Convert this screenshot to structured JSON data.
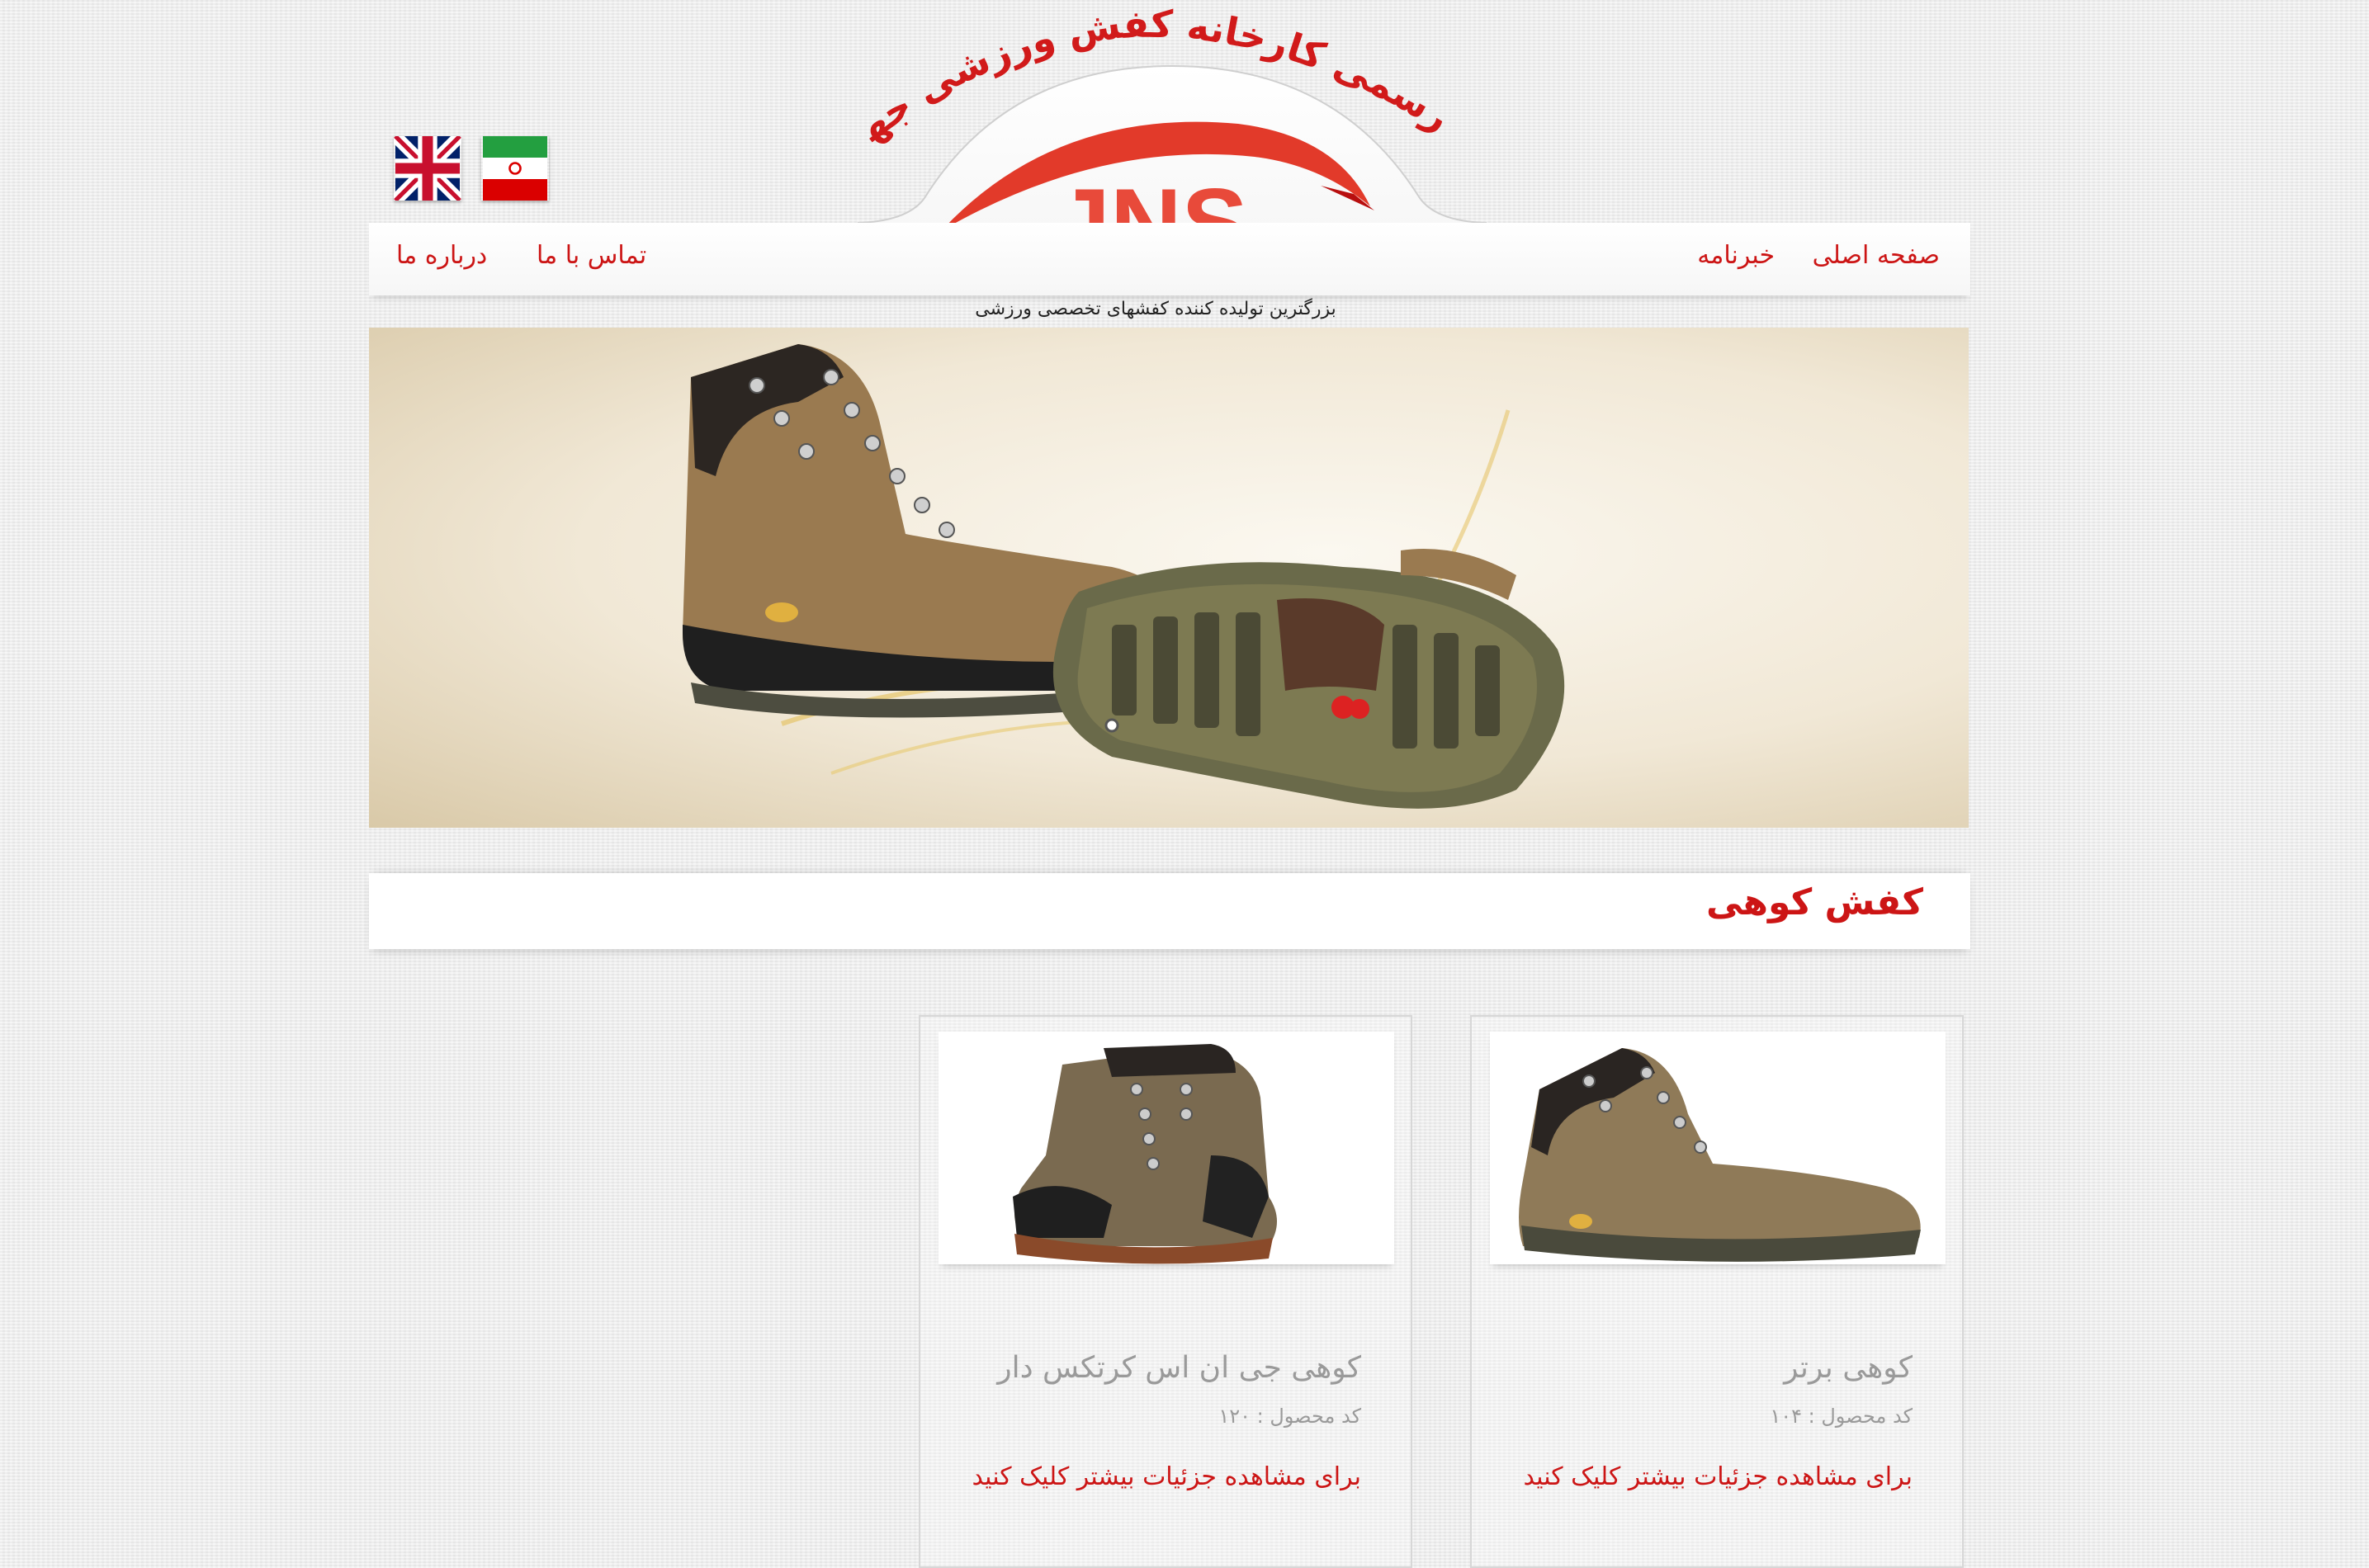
{
  "header": {
    "site_title": "سایت رسمی کارخانه کفش ورزشی جهاد نما",
    "logo_text": "JNS",
    "tagline": "بزرگترین تولیده کننده کفشهای تخصصی ورزشی"
  },
  "nav": {
    "home": "صفحه اصلی",
    "newsletter": "خبرنامه",
    "contact": "تماس با ما",
    "about": "درباره ما"
  },
  "languages": [
    "english-flag",
    "iran-flag"
  ],
  "category": {
    "title": "کفش کوهی"
  },
  "products": [
    {
      "name": "کوهی برتر",
      "code": "کد محصول : ۱۰۴",
      "link": "برای مشاهده جزئیات بیشتر کلیک کنید"
    },
    {
      "name": "کوهی جی ان اس کرتکس دار",
      "code": "کد محصول : ۱۲۰",
      "link": "برای مشاهده جزئیات بیشتر کلیک کنید"
    }
  ],
  "colors": {
    "accent": "#cc1515",
    "muted_text": "#9a9a9a"
  }
}
